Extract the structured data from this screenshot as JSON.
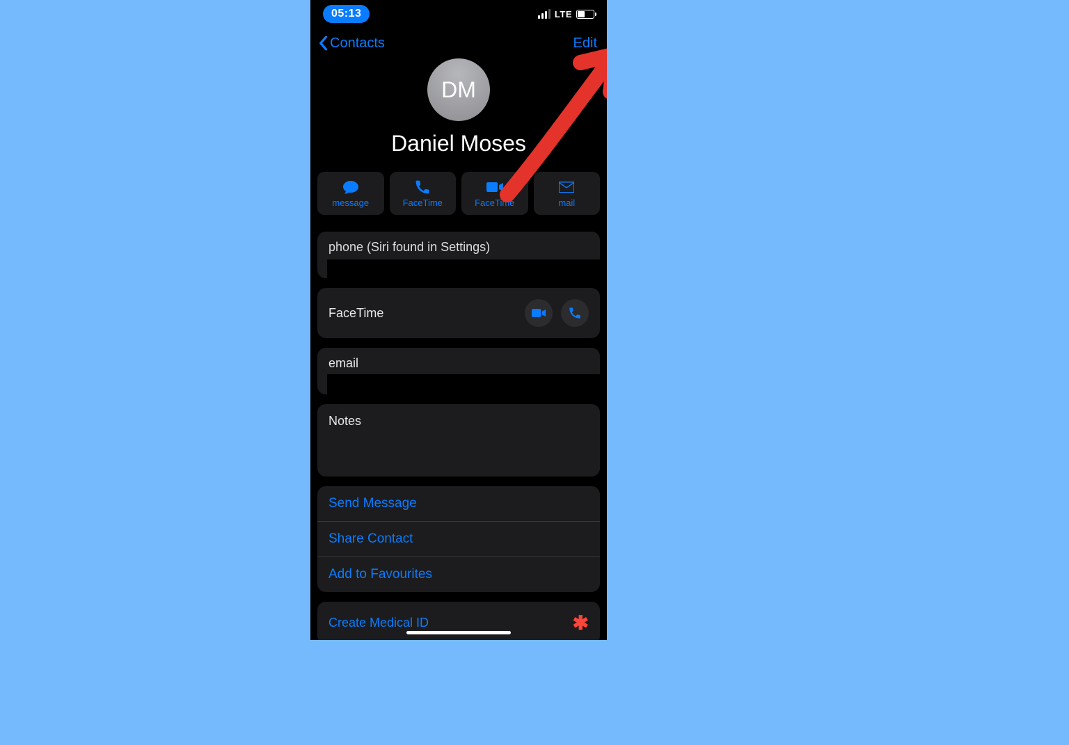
{
  "statusbar": {
    "time": "05:13",
    "carrier": "LTE"
  },
  "nav": {
    "back": "Contacts",
    "edit": "Edit"
  },
  "contact": {
    "initials": "DM",
    "name": "Daniel Moses"
  },
  "actions": [
    {
      "label": "message",
      "icon": "message"
    },
    {
      "label": "FaceTime",
      "icon": "phone"
    },
    {
      "label": "FaceTime",
      "icon": "video"
    },
    {
      "label": "mail",
      "icon": "mail"
    }
  ],
  "phone_label": "phone (Siri found in Settings)",
  "facetime_label": "FaceTime",
  "email_label": "email",
  "notes_label": "Notes",
  "links": {
    "send_message": "Send Message",
    "share_contact": "Share Contact",
    "add_favourite": "Add to Favourites",
    "medical_id": "Create Medical ID"
  }
}
